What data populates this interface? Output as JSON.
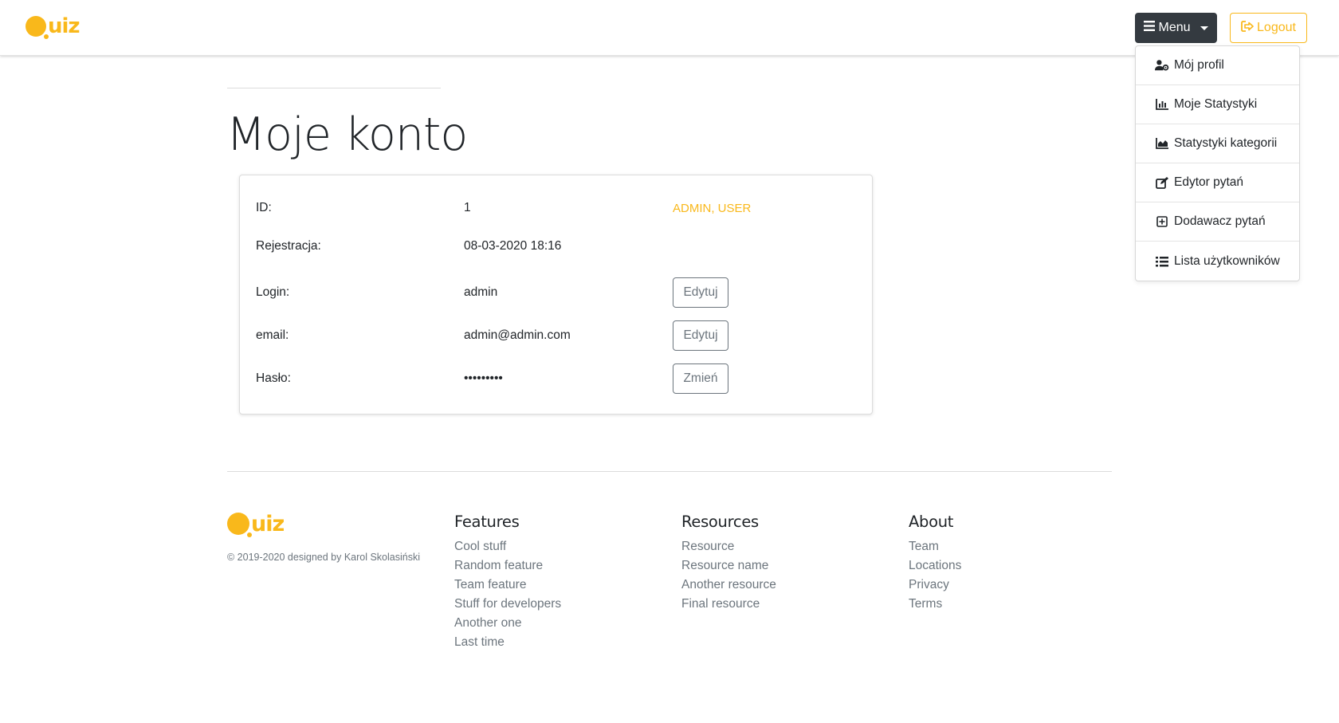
{
  "brand": {
    "logo_text": "uiz",
    "accent": "#f9b81b",
    "dark": "#343a40"
  },
  "navbar": {
    "menu_label": "Menu",
    "logout_label": "Logout",
    "menu_icon": "bars-icon",
    "logout_icon": "sign-out-icon"
  },
  "dropdown": {
    "items": [
      {
        "label": "Mój profil",
        "icon": "user-cog-icon"
      },
      {
        "label": "Moje Statystyki",
        "icon": "bar-chart-icon"
      },
      {
        "label": "Statystyki kategorii",
        "icon": "area-chart-icon"
      },
      {
        "label": "Edytor pytań",
        "icon": "edit-icon"
      },
      {
        "label": "Dodawacz pytań",
        "icon": "plus-square-icon"
      },
      {
        "label": "Lista użytkowników",
        "icon": "list-icon"
      }
    ]
  },
  "page": {
    "title": "Moje konto"
  },
  "account": {
    "id_label": "ID:",
    "id_value": "1",
    "roles": "ADMIN, USER",
    "registration_label": "Rejestracja:",
    "registration_value": "08-03-2020 18:16",
    "login_label": "Login:",
    "login_value": "admin",
    "login_button": "Edytuj",
    "email_label": "email:",
    "email_value": "admin@admin.com",
    "email_button": "Edytuj",
    "password_label": "Hasło:",
    "password_value": "•••••••••",
    "password_button": "Zmień"
  },
  "footer": {
    "copyright": "© 2019-2020 designed by Karol Skolasiński",
    "columns": [
      {
        "title": "Features",
        "links": [
          "Cool stuff",
          "Random feature",
          "Team feature",
          "Stuff for developers",
          "Another one",
          "Last time"
        ]
      },
      {
        "title": "Resources",
        "links": [
          "Resource",
          "Resource name",
          "Another resource",
          "Final resource"
        ]
      },
      {
        "title": "About",
        "links": [
          "Team",
          "Locations",
          "Privacy",
          "Terms"
        ]
      }
    ]
  }
}
